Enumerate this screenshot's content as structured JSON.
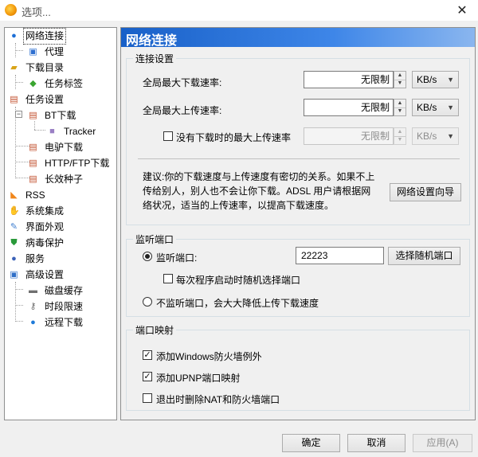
{
  "window": {
    "title": "选项...",
    "close": "✕"
  },
  "tree": {
    "items": [
      {
        "label": "网络连接"
      },
      {
        "label": "代理"
      },
      {
        "label": "下载目录"
      },
      {
        "label": "任务标签"
      },
      {
        "label": "任务设置"
      },
      {
        "label": "BT下载"
      },
      {
        "label": "Tracker"
      },
      {
        "label": "电驴下载"
      },
      {
        "label": "HTTP/FTP下载"
      },
      {
        "label": "长效种子"
      },
      {
        "label": "RSS"
      },
      {
        "label": "系统集成"
      },
      {
        "label": "界面外观"
      },
      {
        "label": "病毒保护"
      },
      {
        "label": "服务"
      },
      {
        "label": "高级设置"
      },
      {
        "label": "磁盘缓存"
      },
      {
        "label": "时段限速"
      },
      {
        "label": "远程下载"
      }
    ]
  },
  "panel": {
    "title": "网络连接"
  },
  "connection": {
    "group_title": "连接设置",
    "max_download_label": "全局最大下载速率:",
    "max_download_value": "无限制",
    "max_download_unit": "KB/s",
    "max_upload_label": "全局最大上传速率:",
    "max_upload_value": "无限制",
    "max_upload_unit": "KB/s",
    "idle_upload_label": "没有下载时的最大上传速率",
    "idle_upload_value": "无限制",
    "idle_upload_unit": "KB/s",
    "advice_line1": "建议:你的下载速度与上传速度有密切的关系。如果不上",
    "advice_line2": "传给别人，别人也不会让你下载。ADSL 用户请根据网",
    "advice_line3": "络状况，适当的上传速率，以提高下载速度。",
    "wizard_button": "网络设置向导"
  },
  "listen": {
    "group_title": "监听端口",
    "port_label": "监听端口:",
    "port_value": "22223",
    "random_button": "选择随机端口",
    "random_on_start_label": "每次程序启动时随机选择端口",
    "no_listen_label": "不监听端口，会大大降低上传下载速度"
  },
  "mapping": {
    "group_title": "端口映射",
    "firewall_label": "添加Windows防火墙例外",
    "upnp_label": "添加UPNP端口映射",
    "remove_label": "退出时删除NAT和防火墙端口"
  },
  "buttons": {
    "ok": "确定",
    "cancel": "取消",
    "apply": "应用(A)"
  },
  "colors": {
    "header_start": "#1860c8",
    "header_end": "#8ab6ef"
  }
}
